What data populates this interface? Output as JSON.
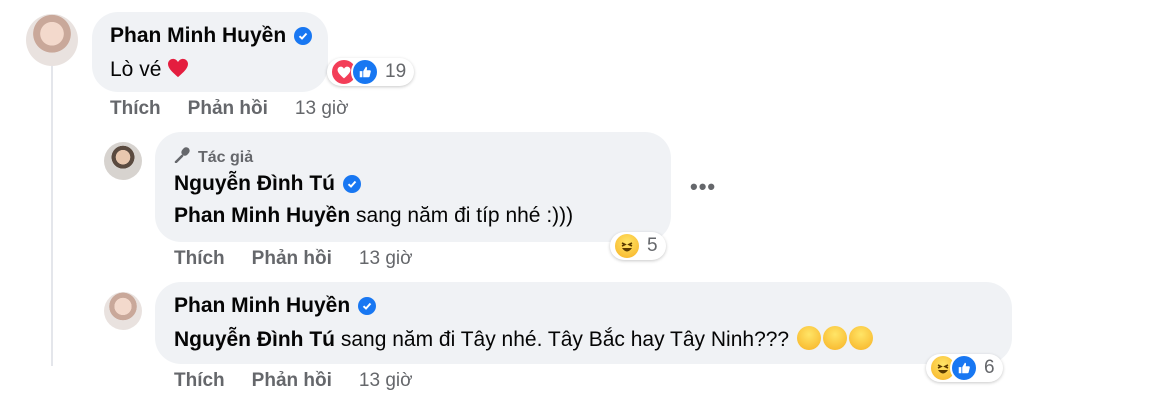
{
  "comments": [
    {
      "author": "Phan Minh Huyền",
      "text": "Lò vé",
      "reaction_count": "19",
      "actions": {
        "like": "Thích",
        "reply": "Phản hồi",
        "time": "13 giờ"
      }
    },
    {
      "author_tag": "Tác giả",
      "author": "Nguyễn Đình Tú",
      "mention": "Phan Minh Huyền",
      "text": " sang năm đi típ nhé :)))",
      "reaction_count": "5",
      "actions": {
        "like": "Thích",
        "reply": "Phản hồi",
        "time": "13 giờ"
      }
    },
    {
      "author": "Phan Minh Huyền",
      "mention": "Nguyễn Đình Tú",
      "text": " sang năm đi Tây nhé. Tây Bắc hay Tây Ninh??? ",
      "reaction_count": "6",
      "actions": {
        "like": "Thích",
        "reply": "Phản hồi",
        "time": "13 giờ"
      }
    }
  ],
  "more_label": "•••",
  "colors": {
    "bubble": "#f0f2f5",
    "secondary_text": "#65676b",
    "verified": "#1877f2",
    "love": "#f33e58",
    "like": "#1877f2",
    "haha": "#f7b125"
  },
  "icons": [
    "verified-badge-icon",
    "love-reaction-icon",
    "like-reaction-icon",
    "haha-reaction-icon",
    "heart-emoji-icon",
    "microphone-icon",
    "more-options-icon"
  ]
}
